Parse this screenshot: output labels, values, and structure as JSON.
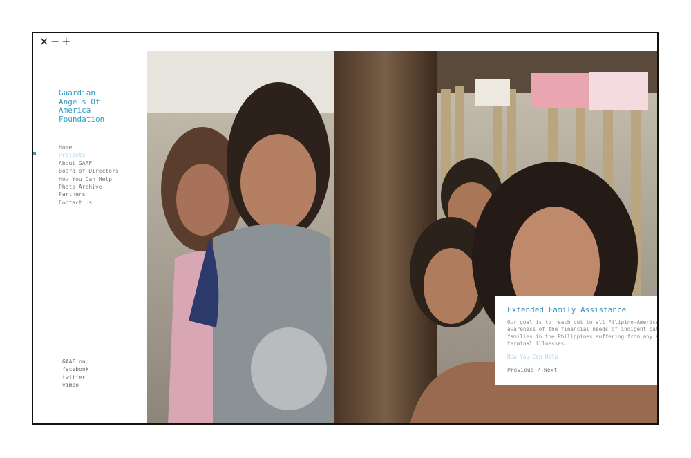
{
  "window": {
    "close": "×",
    "minimize": "−",
    "maximize": "+"
  },
  "site": {
    "title": "Guardian\nAngels Of\nAmerica\nFoundation"
  },
  "nav": {
    "items": [
      {
        "label": "Home"
      },
      {
        "label": "Projects"
      },
      {
        "label": "About GAAF"
      },
      {
        "label": "Board of Directors"
      },
      {
        "label": "How You Can Help"
      },
      {
        "label": "Photo Archive"
      },
      {
        "label": "Partners"
      },
      {
        "label": "Contact Us"
      }
    ],
    "active": "Projects"
  },
  "social": {
    "heading": "GAAF on:",
    "links": [
      "facebook",
      "twitter",
      "vimeo"
    ]
  },
  "slide": {
    "title": "Extended Family Assistance",
    "body": "Our goal is to reach out to all Filipino-Americans and raise awareness of the financial needs of indigent patients and their families in the Philippines suffering from any acute, chronic or terminal illnesses.",
    "link": "How You Can Help",
    "previous": "Previous",
    "separator": "/",
    "next": "Next"
  },
  "colors": {
    "accent": "#3a9bc1",
    "accent_light": "#a9d4e6",
    "text_gray": "#777777"
  }
}
